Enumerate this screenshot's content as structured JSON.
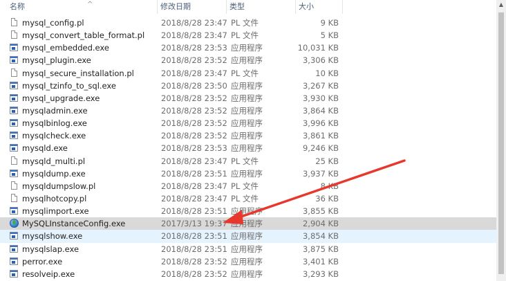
{
  "columns": {
    "name": "名称",
    "date": "修改日期",
    "type": "类型",
    "size": "大小"
  },
  "files": [
    {
      "name": "mysql_config.pl",
      "date": "2018/8/28 23:47",
      "type": "PL 文件",
      "size": "9 KB",
      "icon": "file-icon"
    },
    {
      "name": "mysql_convert_table_format.pl",
      "date": "2018/8/28 23:47",
      "type": "PL 文件",
      "size": "5 KB",
      "icon": "file-icon"
    },
    {
      "name": "mysql_embedded.exe",
      "date": "2018/8/28 23:53",
      "type": "应用程序",
      "size": "10,031 KB",
      "icon": "exe-icon"
    },
    {
      "name": "mysql_plugin.exe",
      "date": "2018/8/28 23:52",
      "type": "应用程序",
      "size": "3,306 KB",
      "icon": "exe-icon"
    },
    {
      "name": "mysql_secure_installation.pl",
      "date": "2018/8/28 23:47",
      "type": "PL 文件",
      "size": "10 KB",
      "icon": "file-icon"
    },
    {
      "name": "mysql_tzinfo_to_sql.exe",
      "date": "2018/8/28 23:50",
      "type": "应用程序",
      "size": "3,267 KB",
      "icon": "exe-icon"
    },
    {
      "name": "mysql_upgrade.exe",
      "date": "2018/8/28 23:52",
      "type": "应用程序",
      "size": "3,930 KB",
      "icon": "exe-icon"
    },
    {
      "name": "mysqladmin.exe",
      "date": "2018/8/28 23:52",
      "type": "应用程序",
      "size": "3,864 KB",
      "icon": "exe-icon"
    },
    {
      "name": "mysqlbinlog.exe",
      "date": "2018/8/28 23:52",
      "type": "应用程序",
      "size": "3,996 KB",
      "icon": "exe-icon"
    },
    {
      "name": "mysqlcheck.exe",
      "date": "2018/8/28 23:52",
      "type": "应用程序",
      "size": "3,861 KB",
      "icon": "exe-icon"
    },
    {
      "name": "mysqld.exe",
      "date": "2018/8/28 23:53",
      "type": "应用程序",
      "size": "9,246 KB",
      "icon": "exe-icon"
    },
    {
      "name": "mysqld_multi.pl",
      "date": "2018/8/28 23:47",
      "type": "PL 文件",
      "size": "25 KB",
      "icon": "file-icon"
    },
    {
      "name": "mysqldump.exe",
      "date": "2018/8/28 23:51",
      "type": "应用程序",
      "size": "3,937 KB",
      "icon": "exe-icon"
    },
    {
      "name": "mysqldumpslow.pl",
      "date": "2018/8/28 23:47",
      "type": "PL 文件",
      "size": "8 KB",
      "icon": "file-icon"
    },
    {
      "name": "mysqlhotcopy.pl",
      "date": "2018/8/28 23:47",
      "type": "PL 文件",
      "size": "36 KB",
      "icon": "file-icon"
    },
    {
      "name": "mysqlimport.exe",
      "date": "2018/8/28 23:51",
      "type": "应用程序",
      "size": "3,855 KB",
      "icon": "exe-icon"
    },
    {
      "name": "MySQLInstanceConfig.exe",
      "date": "2017/3/13 19:37",
      "type": "应用程序",
      "size": "2,904 KB",
      "icon": "globe-icon",
      "state": "selected"
    },
    {
      "name": "mysqlshow.exe",
      "date": "2018/8/28 23:51",
      "type": "应用程序",
      "size": "3,854 KB",
      "icon": "exe-icon",
      "state": "hovered"
    },
    {
      "name": "mysqlslap.exe",
      "date": "2018/8/28 23:51",
      "type": "应用程序",
      "size": "3,875 KB",
      "icon": "exe-icon"
    },
    {
      "name": "perror.exe",
      "date": "2018/8/28 23:52",
      "type": "应用程序",
      "size": "3,401 KB",
      "icon": "exe-icon"
    },
    {
      "name": "resolveip.exe",
      "date": "2018/8/28 23:52",
      "type": "应用程序",
      "size": "3,293 KB",
      "icon": "exe-icon"
    }
  ],
  "annotation": {
    "color": "#e8372c",
    "icon": "red-arrow-annotation"
  }
}
